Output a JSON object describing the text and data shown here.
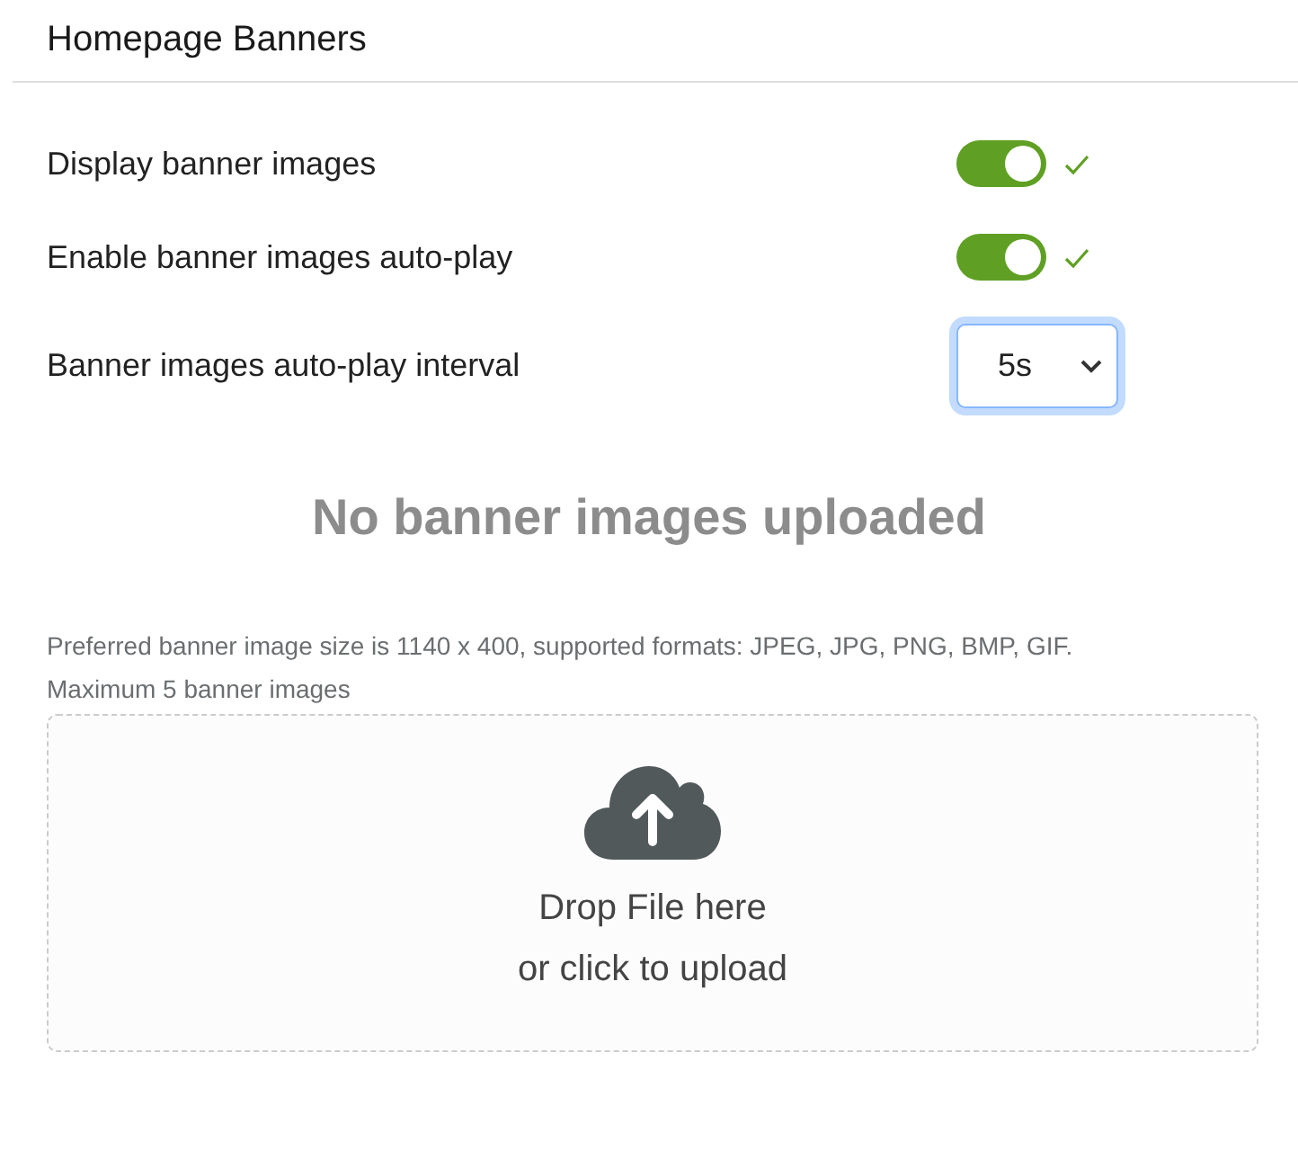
{
  "section": {
    "title": "Homepage Banners"
  },
  "settings": [
    {
      "kind": "toggle",
      "label": "Display banner images",
      "on": true,
      "saved": true
    },
    {
      "kind": "toggle",
      "label": "Enable banner images auto-play",
      "on": true,
      "saved": true
    },
    {
      "kind": "select",
      "label": "Banner images auto-play interval",
      "value": "5s",
      "focused": true
    }
  ],
  "empty_message": "No banner images uploaded",
  "help_lines": [
    "Preferred banner image size is 1140 x 400, supported formats: JPEG, JPG, PNG, BMP, GIF.",
    "Maximum 5 banner images"
  ],
  "dropzone": {
    "lines": [
      "Drop File here",
      "or click to upload"
    ]
  }
}
